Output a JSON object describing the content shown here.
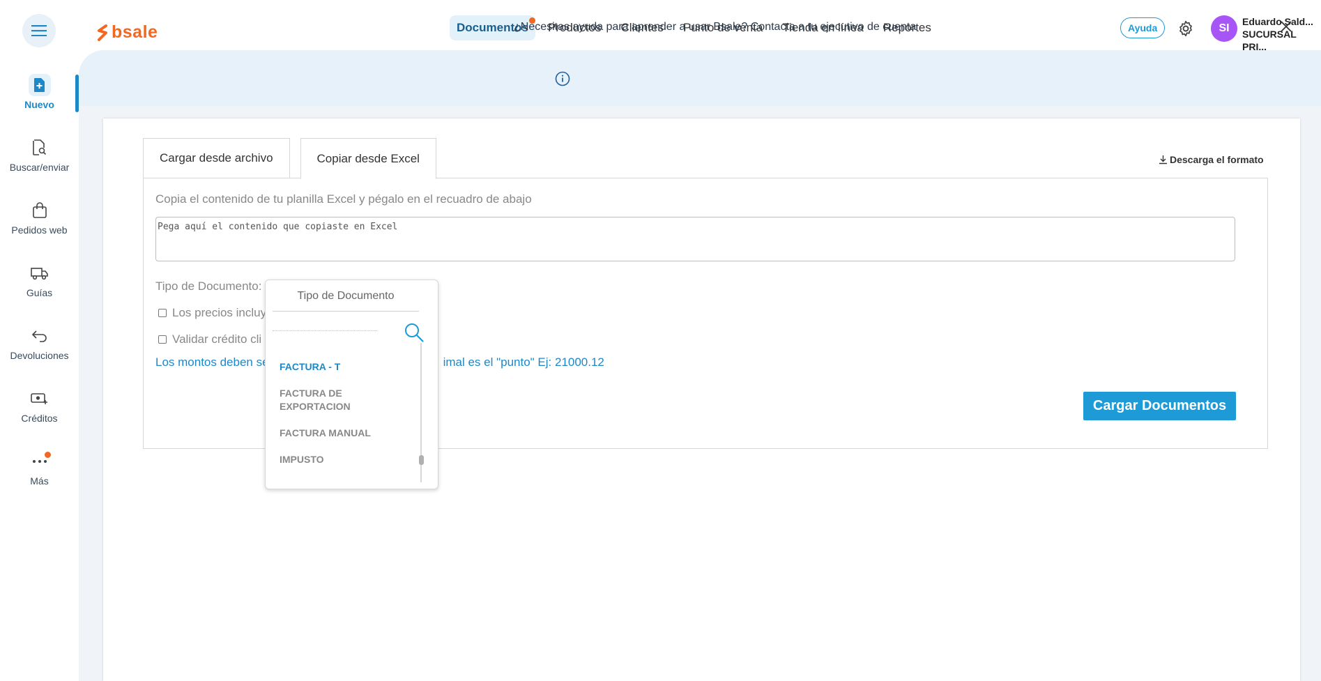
{
  "header": {
    "logo_text": "bsale",
    "nav": [
      {
        "label": "Documentos",
        "active": true,
        "badge": true
      },
      {
        "label": "Productos"
      },
      {
        "label": "Clientes"
      },
      {
        "label": "Punto de venta"
      },
      {
        "label": "Tienda en línea"
      },
      {
        "label": "Reportes"
      }
    ],
    "help_label": "Ayuda",
    "avatar_initials": "SI",
    "user_name": "Eduardo Sald...",
    "user_branch": "SUCURSAL PRI..."
  },
  "sidebar": {
    "items": [
      {
        "label": "Nuevo",
        "icon": "new-document-icon",
        "active": true
      },
      {
        "label": "Buscar/enviar",
        "icon": "search-document-icon"
      },
      {
        "label": "Pedidos web",
        "icon": "shopping-bag-icon"
      },
      {
        "label": "Guías",
        "icon": "truck-icon"
      },
      {
        "label": "Devoluciones",
        "icon": "return-arrow-icon"
      },
      {
        "label": "Créditos",
        "icon": "money-credit-icon"
      },
      {
        "label": "Más",
        "icon": "more-dots-icon"
      }
    ]
  },
  "banner": {
    "text": "¿Necesitas ayuda para aprender a usar Bsale? Contacta a tu ejecutivo de cuenta"
  },
  "tabs": [
    {
      "label": "Cargar desde archivo"
    },
    {
      "label": "Copiar desde Excel",
      "active": true
    }
  ],
  "download_label": "Descarga el formato",
  "form": {
    "instructions": "Copia el contenido de tu planilla Excel y pégalo en el recuadro de abajo",
    "paste_placeholder": "Pega aquí el contenido que copiaste en Excel",
    "tipo_label": "Tipo de Documento:",
    "check_prices": "Los precios incluy",
    "check_credit": "Validar crédito cli",
    "note_start": "Los montos deben se",
    "note_end": "imal es el \"punto\" Ej: 21000.12",
    "submit_label": "Cargar Documentos"
  },
  "dropdown": {
    "title": "Tipo de Documento",
    "items": [
      {
        "label": "FACTURA - T",
        "selected": true
      },
      {
        "label": "FACTURA DE EXPORTACION"
      },
      {
        "label": "FACTURA MANUAL"
      },
      {
        "label": "IMPUSTO"
      }
    ]
  },
  "colors": {
    "brand": "#f26722",
    "accent": "#1e9bd7",
    "avatar": "#a855f7"
  }
}
